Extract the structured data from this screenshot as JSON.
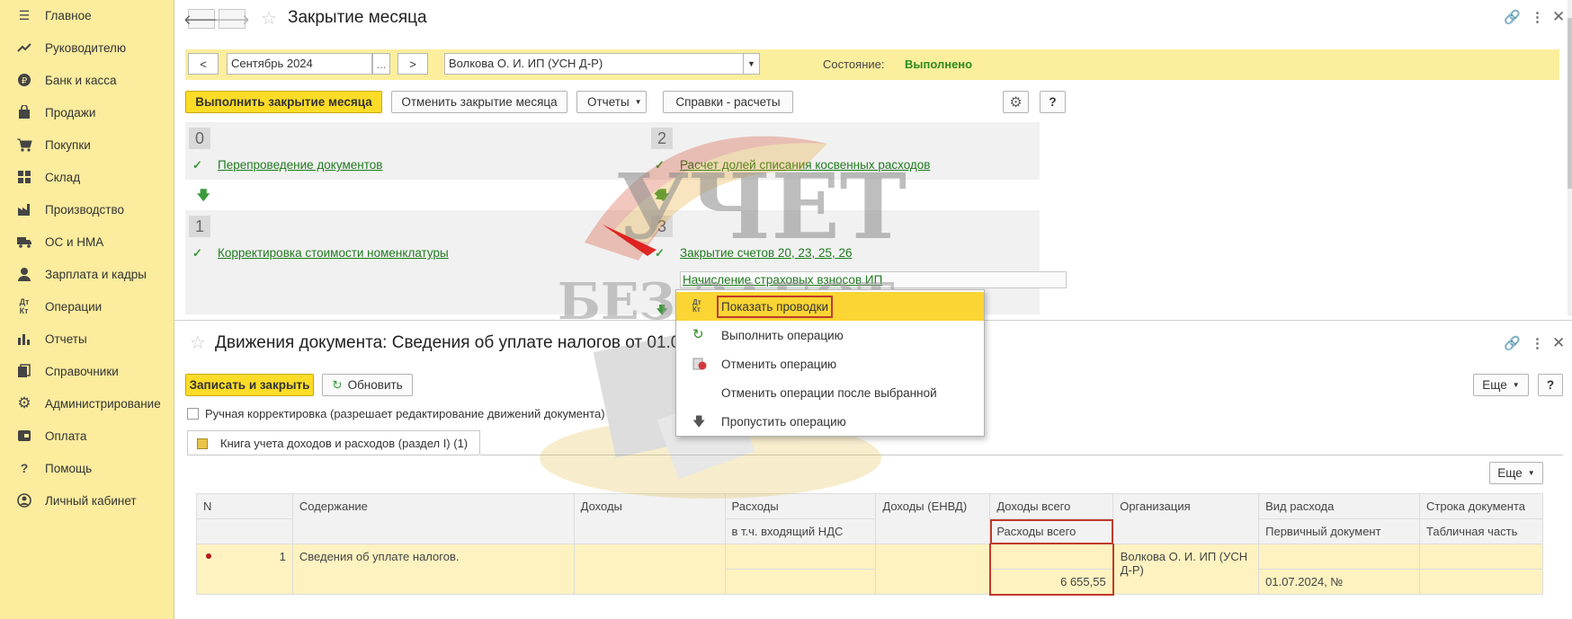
{
  "sidebar": {
    "items": [
      {
        "label": "Главное",
        "icon": "menu-icon"
      },
      {
        "label": "Руководителю",
        "icon": "trend-icon"
      },
      {
        "label": "Банк и касса",
        "icon": "coin-icon"
      },
      {
        "label": "Продажи",
        "icon": "bag-icon"
      },
      {
        "label": "Покупки",
        "icon": "cart-icon"
      },
      {
        "label": "Склад",
        "icon": "grid-icon"
      },
      {
        "label": "Производство",
        "icon": "factory-icon"
      },
      {
        "label": "ОС и НМА",
        "icon": "truck-icon"
      },
      {
        "label": "Зарплата и кадры",
        "icon": "person-icon"
      },
      {
        "label": "Операции",
        "icon": "dt-kt-icon"
      },
      {
        "label": "Отчеты",
        "icon": "barchart-icon"
      },
      {
        "label": "Справочники",
        "icon": "books-icon"
      },
      {
        "label": "Администрирование",
        "icon": "gear-icon"
      },
      {
        "label": "Оплата",
        "icon": "payment-icon"
      },
      {
        "label": "Помощь",
        "icon": "question-icon"
      },
      {
        "label": "Личный кабинет",
        "icon": "account-icon"
      }
    ]
  },
  "top": {
    "title": "Закрытие месяца",
    "period_prev": "<",
    "period": "Сентябрь 2024",
    "period_more": "...",
    "period_next": ">",
    "organization": "Волкова О. И. ИП (УСН Д-Р)",
    "state_label": "Состояние:",
    "state_value": "Выполнено",
    "state_color": "#2e8b1e",
    "buttons": {
      "run": "Выполнить закрытие месяца",
      "cancel": "Отменить закрытие месяца",
      "reports": "Отчеты",
      "refs": "Справки - расчеты",
      "help": "?"
    },
    "steps": [
      {
        "num": "0",
        "items": [
          "Перепроведение документов"
        ]
      },
      {
        "num": "1",
        "items": [
          "Корректировка стоимости номенклатуры"
        ]
      },
      {
        "num": "2",
        "items": [
          "Расчет долей списания косвенных расходов"
        ]
      },
      {
        "num": "3",
        "items": [
          "Закрытие счетов 20, 23, 25, 26",
          "Начисление страховых взносов ИП"
        ]
      }
    ]
  },
  "context_menu": {
    "items": [
      {
        "label": "Показать проводки",
        "icon": "dt-kt-icon"
      },
      {
        "label": "Выполнить операцию",
        "icon": "refresh-green-icon"
      },
      {
        "label": "Отменить операцию",
        "icon": "cancel-red-icon"
      },
      {
        "label": "Отменить операции после выбранной",
        "icon": ""
      },
      {
        "label": "Пропустить операцию",
        "icon": "arrow-down-icon"
      }
    ]
  },
  "bottom": {
    "title": "Движения документа: Сведения об уплате налогов от 01.07",
    "buttons": {
      "save_close": "Записать и закрыть",
      "refresh": "Обновить",
      "more": "Еще",
      "help": "?",
      "table_more": "Еще"
    },
    "manual_checkbox": "Ручная корректировка (разрешает редактирование движений документа)",
    "tab": "Книга учета доходов и расходов (раздел I) (1)",
    "table": {
      "headers_row1": [
        "N",
        "Содержание",
        "Доходы",
        "Расходы",
        "Доходы (ЕНВД)",
        "Доходы всего",
        "Организация",
        "Вид расхода",
        "Строка документа"
      ],
      "headers_row2": [
        "в т.ч. входящий НДС",
        "Расходы всего",
        "Первичный документ",
        "Табличная часть"
      ],
      "row": {
        "n": "1",
        "content": "Сведения об уплате налогов.",
        "expenses_total": "6 655,55",
        "organization": "Волкова О. И. ИП (УСН Д-Р)",
        "primary_doc": "01.07.2024, №"
      }
    }
  },
  "watermark": {
    "line1": "УЧЕТ",
    "line2": "БЕЗ ЗАБОТ"
  }
}
